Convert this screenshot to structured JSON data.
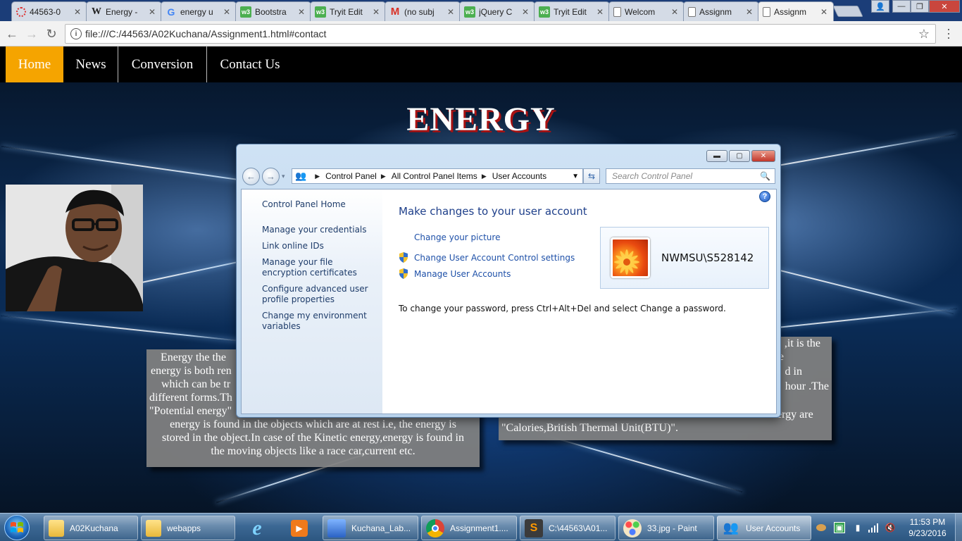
{
  "browser": {
    "tabs": [
      {
        "title": "44563-0",
        "icon": "loading-spinner-icon"
      },
      {
        "title": "Energy -",
        "icon": "wikipedia-icon"
      },
      {
        "title": "energy u",
        "icon": "google-icon"
      },
      {
        "title": "Bootstra",
        "icon": "w3schools-icon"
      },
      {
        "title": "Tryit Edit",
        "icon": "w3schools-icon"
      },
      {
        "title": "(no subj",
        "icon": "gmail-icon"
      },
      {
        "title": "jQuery C",
        "icon": "w3schools-icon"
      },
      {
        "title": "Tryit Edit",
        "icon": "w3schools-icon"
      },
      {
        "title": "Welcom",
        "icon": "document-icon"
      },
      {
        "title": "Assignm",
        "icon": "document-icon"
      },
      {
        "title": "Assignm",
        "icon": "document-icon"
      }
    ],
    "url": "file:///C:/44563/A02Kuchana/Assignment1.html#contact"
  },
  "site": {
    "nav": [
      "Home",
      "News",
      "Conversion",
      "Contact Us"
    ],
    "active_nav": "Home",
    "heading": "ENERGY",
    "left_text_lines": [
      "Energy the the",
      "energy is both ren",
      "which can be tr",
      "different forms.Th",
      "\"Potential energy\"",
      "energy is found in the objects which are at rest i.e, the energy is",
      "stored in the object.In case of the Kinetic energy,energy is found in",
      "the moving objects like a race car,current etc."
    ],
    "right_text_lines": [
      ",it is the",
      "e",
      "d in",
      "hour .The",
      "",
      "measured. 1 Horsel ower = 745.7 Watts .Other units of energy are",
      "\"Calories,British Thermal Unit(BTU)\"."
    ]
  },
  "user_accounts": {
    "breadcrumbs": [
      "Control Panel",
      "All Control Panel Items",
      "User Accounts"
    ],
    "search_placeholder": "Search Control Panel",
    "sidebar": [
      "Control Panel Home",
      "Manage your credentials",
      "Link online IDs",
      "Manage your file encryption certificates",
      "Configure advanced user profile properties",
      "Change my environment variables"
    ],
    "title": "Make changes to your user account",
    "links": [
      "Change your picture",
      "Change User Account Control settings",
      "Manage User Accounts"
    ],
    "note": "To change your password, press Ctrl+Alt+Del and select Change a password.",
    "account_name": "NWMSU\\S528142"
  },
  "taskbar": {
    "items": [
      {
        "label": "A02Kuchana",
        "icon": "folder-icon"
      },
      {
        "label": "webapps",
        "icon": "folder-icon"
      },
      {
        "label": "Kuchana_Lab...",
        "icon": "virtualbox-icon"
      },
      {
        "label": "Assignment1....",
        "icon": "chrome-icon"
      },
      {
        "label": "C:\\44563\\A01...",
        "icon": "sublime-icon"
      },
      {
        "label": "33.jpg - Paint",
        "icon": "paint-icon"
      },
      {
        "label": "User Accounts",
        "icon": "user-accounts-icon"
      }
    ],
    "time": "11:53 PM",
    "date": "9/23/2016"
  },
  "colors": {
    "nav_active": "#f5a400",
    "heading_shadow": "#aa1111",
    "link_blue": "#1e50a8"
  }
}
